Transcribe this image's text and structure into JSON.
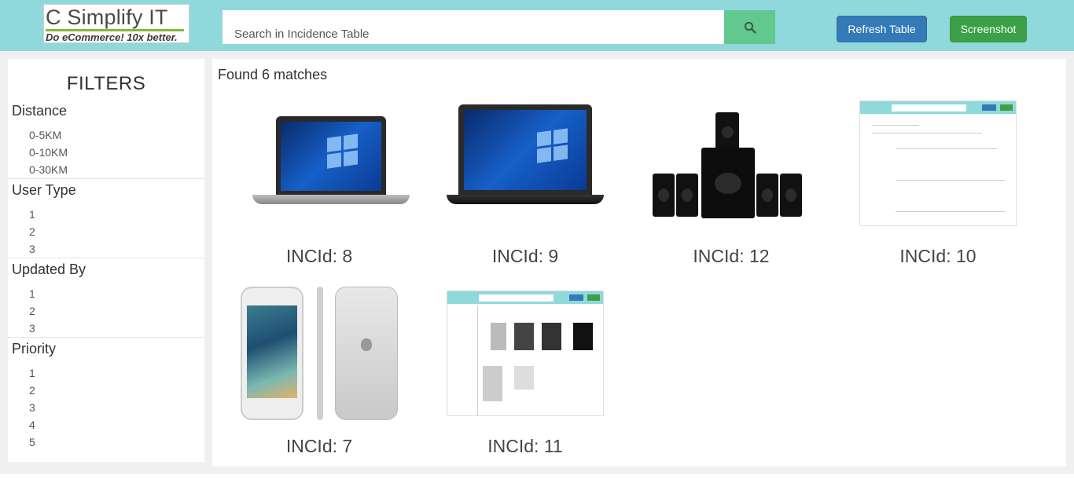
{
  "header": {
    "logo_title": "C Simplify IT",
    "logo_tagline": "Do eCommerce! 10x better.",
    "search_placeholder": "Search in Incidence Table",
    "search_icon": "search-icon",
    "refresh_label": "Refresh Table",
    "screenshot_label": "Screenshot",
    "colors": {
      "header_bg": "#8fd8dc",
      "search_btn": "#62c98e",
      "refresh_btn": "#337ab7",
      "screenshot_btn": "#3ba046"
    }
  },
  "sidebar": {
    "title": "FILTERS",
    "groups": [
      {
        "title": "Distance",
        "options": [
          "0-5KM",
          "0-10KM",
          "0-30KM"
        ]
      },
      {
        "title": "User Type",
        "options": [
          "1",
          "2",
          "3"
        ]
      },
      {
        "title": "Updated By",
        "options": [
          "1",
          "2",
          "3"
        ]
      },
      {
        "title": "Priority",
        "options": [
          "1",
          "2",
          "3",
          "4",
          "5"
        ]
      }
    ]
  },
  "main": {
    "found_text": "Found 6 matches",
    "cards": [
      {
        "label": "INCId: 8",
        "image": "laptop-hp"
      },
      {
        "label": "INCId: 9",
        "image": "laptop-dell"
      },
      {
        "label": "INCId: 12",
        "image": "speaker-system"
      },
      {
        "label": "INCId: 10",
        "image": "app-screenshot"
      },
      {
        "label": "INCId: 7",
        "image": "iphone"
      },
      {
        "label": "INCId: 11",
        "image": "app-screenshot"
      }
    ]
  }
}
